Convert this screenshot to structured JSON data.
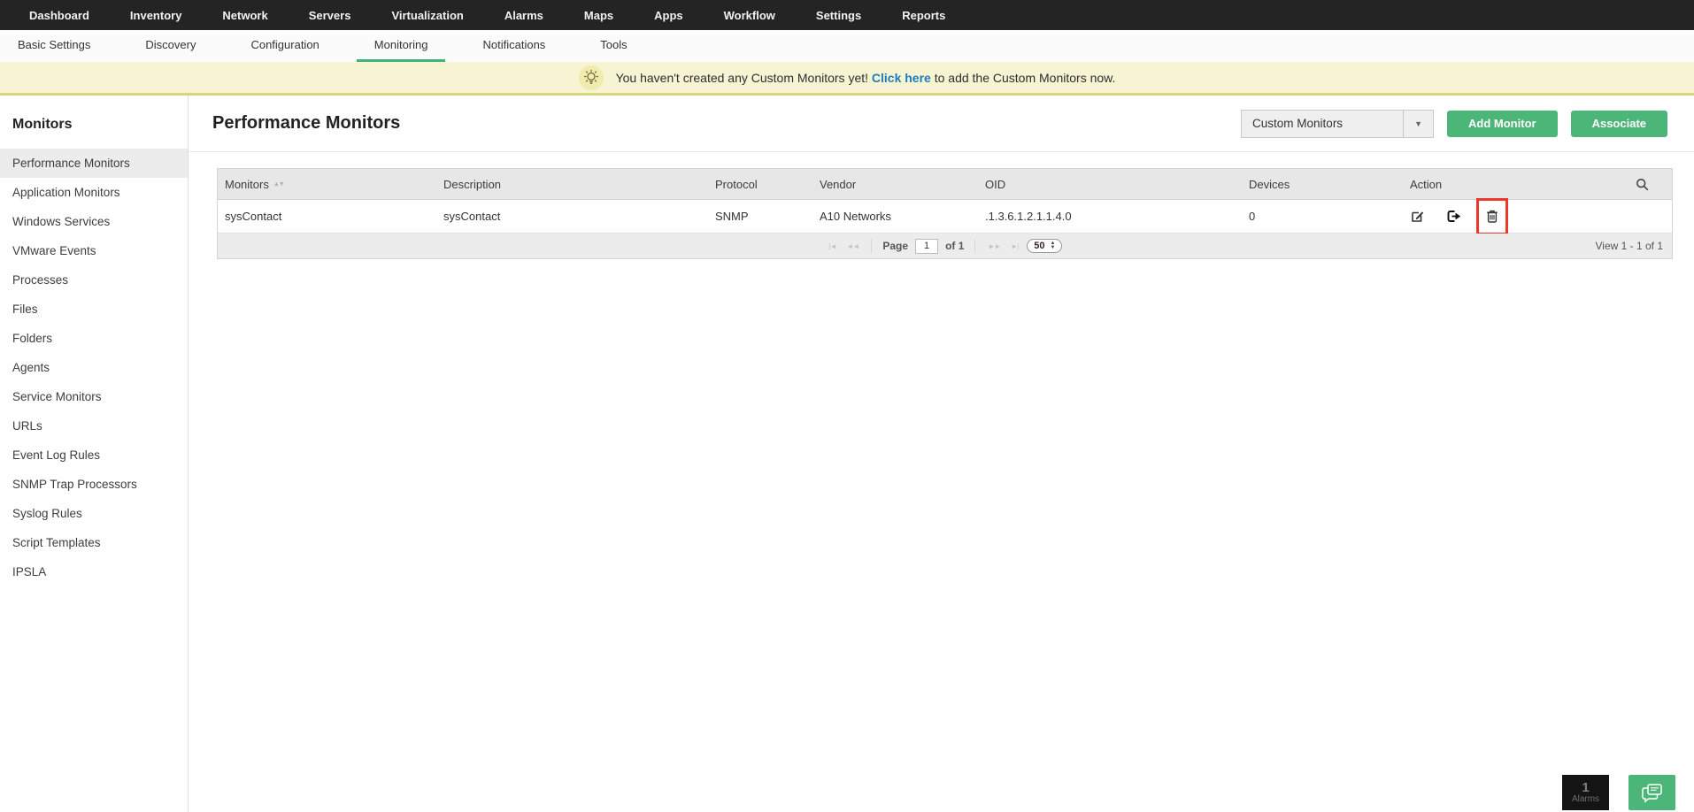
{
  "top_nav": {
    "items": [
      "Dashboard",
      "Inventory",
      "Network",
      "Servers",
      "Virtualization",
      "Alarms",
      "Maps",
      "Apps",
      "Workflow",
      "Settings",
      "Reports"
    ]
  },
  "sub_nav": {
    "items": [
      "Basic Settings",
      "Discovery",
      "Configuration",
      "Monitoring",
      "Notifications",
      "Tools"
    ],
    "active": "Monitoring"
  },
  "banner": {
    "text_before": "You haven't created any Custom Monitors yet! ",
    "link": "Click here",
    "text_after": " to add the Custom Monitors now."
  },
  "sidebar": {
    "title": "Monitors",
    "items": [
      {
        "label": "Performance Monitors",
        "selected": true
      },
      {
        "label": "Application Monitors"
      },
      {
        "label": "Windows Services"
      },
      {
        "label": "VMware Events"
      },
      {
        "label": "Processes"
      },
      {
        "label": "Files"
      },
      {
        "label": "Folders"
      },
      {
        "label": "Agents"
      },
      {
        "label": "Service Monitors"
      },
      {
        "label": "URLs"
      },
      {
        "label": "Event Log Rules"
      },
      {
        "label": "SNMP Trap Processors"
      },
      {
        "label": "Syslog Rules"
      },
      {
        "label": "Script Templates"
      },
      {
        "label": "IPSLA"
      }
    ]
  },
  "main": {
    "title": "Performance Monitors",
    "filter_dropdown": {
      "value": "Custom Monitors"
    },
    "buttons": {
      "add": "Add Monitor",
      "associate": "Associate"
    },
    "table": {
      "columns": [
        "Monitors",
        "Description",
        "Protocol",
        "Vendor",
        "OID",
        "Devices",
        "Action"
      ],
      "rows": [
        {
          "monitor": "sysContact",
          "description": "sysContact",
          "protocol": "SNMP",
          "vendor": "A10 Networks",
          "oid": ".1.3.6.1.2.1.1.4.0",
          "devices": "0"
        }
      ]
    },
    "pagination": {
      "page_label": "Page",
      "page_value": "1",
      "of_label": "of 1",
      "page_size": "50",
      "view_text": "View 1 - 1 of 1"
    }
  },
  "footer": {
    "alarms_count": "1",
    "alarms_label": "Alarms"
  },
  "icons": {
    "sort": "▲▼",
    "dropdown_arrow": "▼",
    "pg_first": "|◄",
    "pg_prev": "◄◄",
    "pg_next": "►►",
    "pg_last": "►|"
  },
  "colors": {
    "topnav_bg": "#242424",
    "accent_green": "#4cb578",
    "tab_underline_green": "#3eb37a",
    "banner_bg": "#f7f4d3",
    "link_blue": "#1d7bbf",
    "annotation_red": "#e8392b"
  }
}
